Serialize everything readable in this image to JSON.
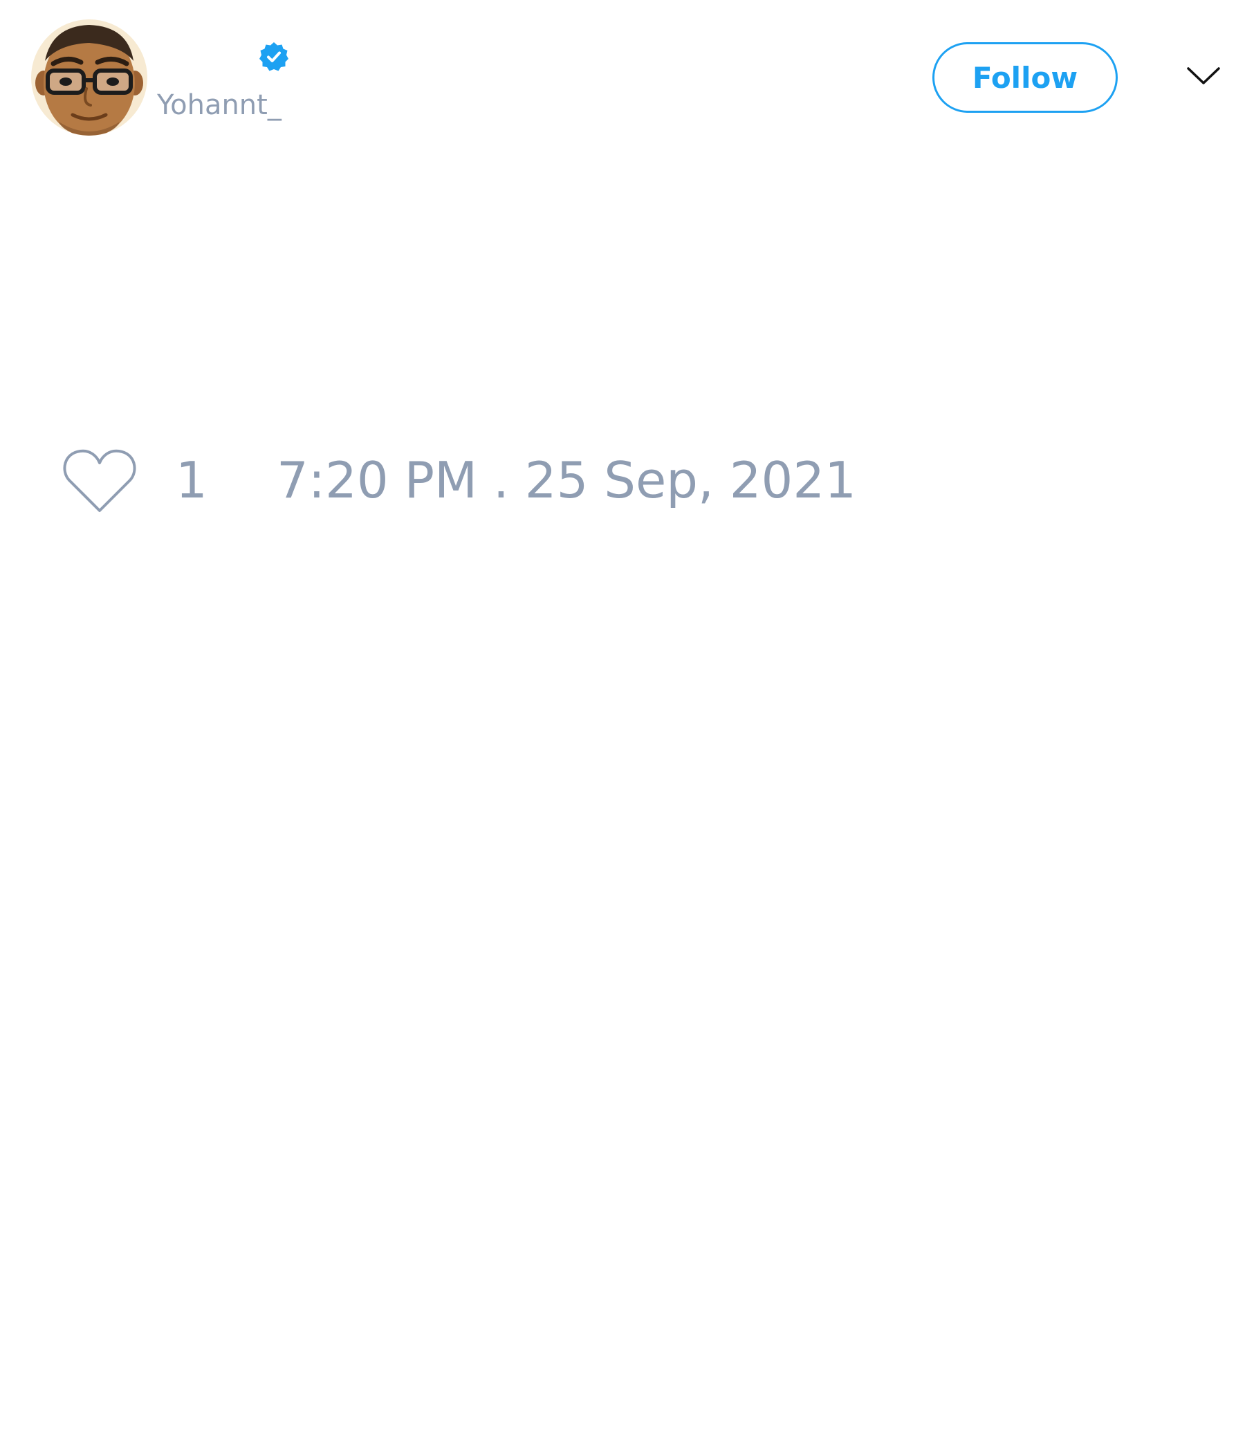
{
  "tweet": {
    "author": {
      "username": "Yohannt_",
      "verified": true,
      "avatar": "cartoon-man-with-glasses"
    },
    "follow_label": "Follow",
    "likes": "1",
    "timestamp": "7:20 PM . 25 Sep, 2021"
  },
  "icons": {
    "verified": "verified-badge-icon",
    "menu": "chevron-down-icon",
    "like": "heart-icon"
  },
  "colors": {
    "accent": "#1da1f2",
    "muted_text": "#8f9db2",
    "background": "#ffffff"
  }
}
